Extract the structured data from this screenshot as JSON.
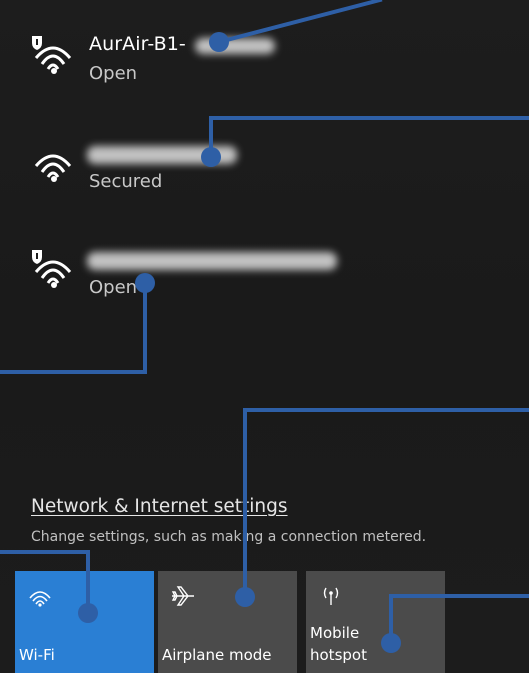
{
  "networks": [
    {
      "name": "AurAir-B1-",
      "status": "Open",
      "secure_shield": true
    },
    {
      "name": "",
      "status": "Secured",
      "secure_shield": false
    },
    {
      "name": "",
      "status": "Open",
      "secure_shield": true
    }
  ],
  "settings": {
    "link_label": "Network & Internet settings",
    "description": "Change settings, such as making a connection metered."
  },
  "tiles": [
    {
      "label": "Wi-Fi",
      "icon": "wifi-icon",
      "active": true
    },
    {
      "label": "Airplane mode",
      "icon": "airplane-icon",
      "active": false
    },
    {
      "label": "Mobile\nhotspot",
      "icon": "hotspot-icon",
      "active": false
    }
  ],
  "colors": {
    "background": "#1c1c1c",
    "tile": "#4b4b4b",
    "tile_active": "#2a7fd4",
    "annotation": "#2e5fa6"
  }
}
